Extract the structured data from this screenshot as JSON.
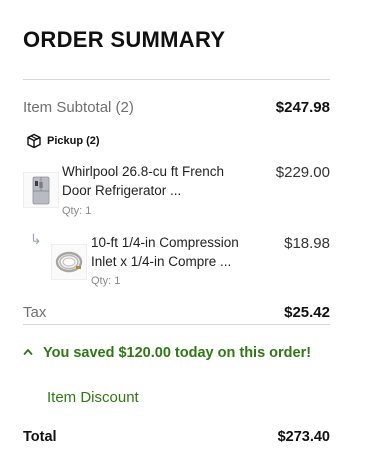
{
  "summary": {
    "title": "ORDER SUMMARY",
    "subtotal_label": "Item Subtotal (2)",
    "subtotal_value": "$247.98",
    "pickup_label": "Pickup (2)",
    "items": [
      {
        "name": "Whirlpool 26.8-cu ft French Door Refrigerator ...",
        "price": "$229.00",
        "qty": "Qty: 1"
      },
      {
        "name": "10-ft 1/4-in Compression Inlet x 1/4-in Compre ...",
        "price": "$18.98",
        "qty": "Qty: 1"
      }
    ],
    "tax_label": "Tax",
    "tax_value": "$25.42",
    "saved_message": "You saved $120.00 today on this order!",
    "discount_label": "Item Discount",
    "total_label": "Total",
    "total_value": "$273.40"
  },
  "icons": {
    "pickup": "box-icon",
    "savings_toggle": "chevron-up-icon",
    "sub_item": "sub-item-arrow-icon"
  },
  "colors": {
    "savings_green": "#2d7a14",
    "muted_text": "#707070"
  }
}
